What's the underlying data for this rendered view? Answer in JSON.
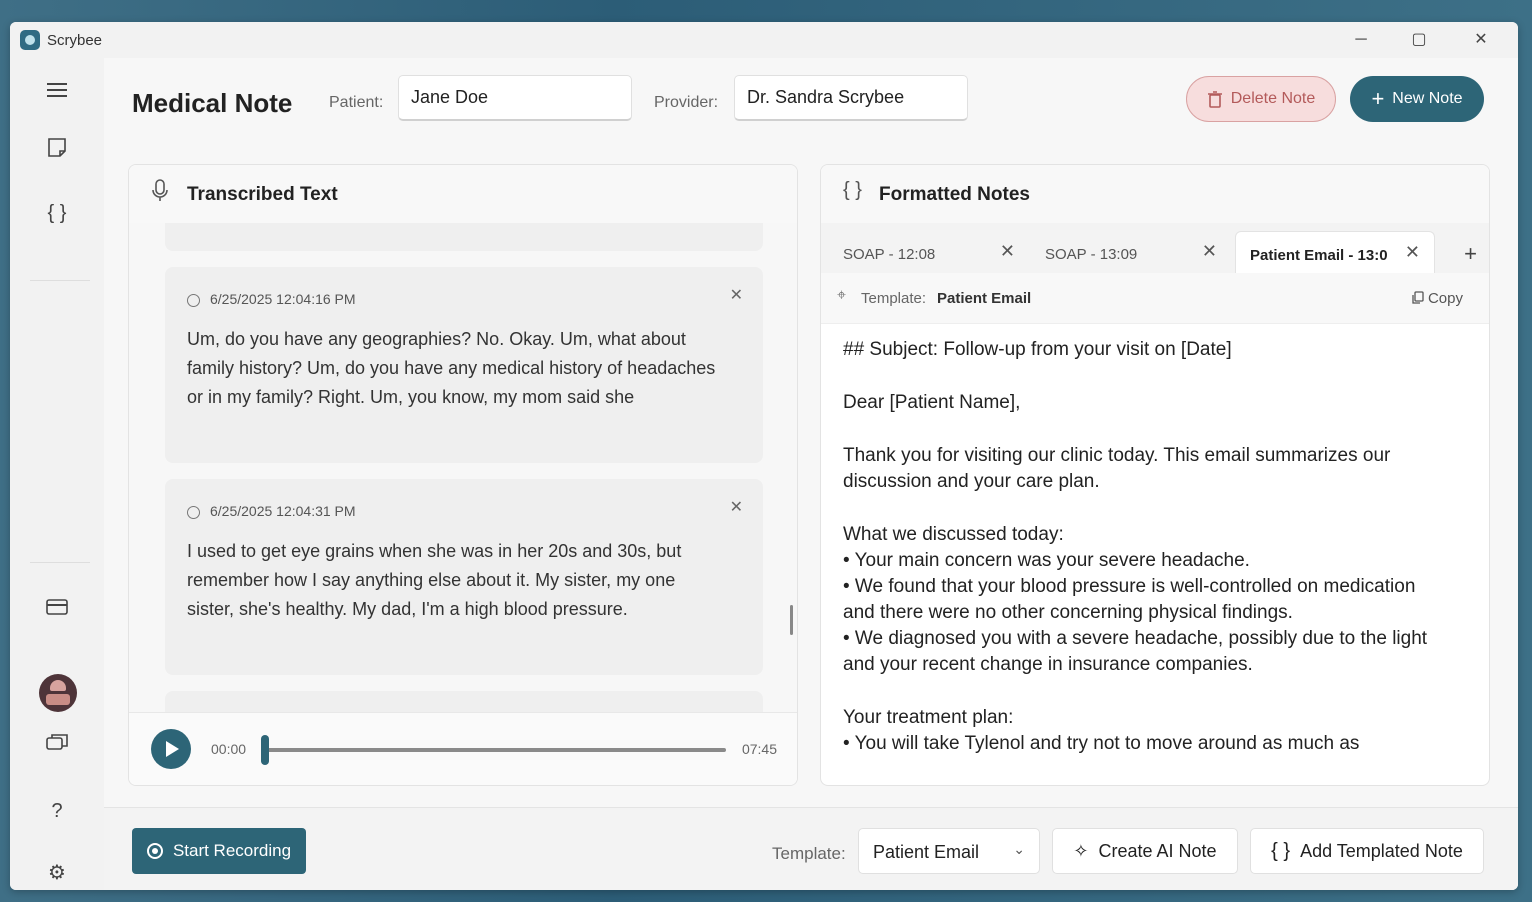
{
  "window": {
    "app_title": "Scrybee",
    "controls": {
      "minimize": "─",
      "maximize": "▢",
      "close": "✕"
    }
  },
  "sidebar": {
    "icons": [
      "hamburger-menu-icon",
      "note-icon",
      "braces-icon",
      "card-icon",
      "avatar",
      "chat-icon",
      "help-icon",
      "gear-icon"
    ]
  },
  "header": {
    "title": "Medical Note",
    "patient_label": "Patient:",
    "patient_value": "Jane Doe",
    "provider_label": "Provider:",
    "provider_value": "Dr. Sandra Scrybee",
    "delete_label": "Delete Note",
    "new_label": "New Note"
  },
  "transcript": {
    "title": "Transcribed Text",
    "entries": [
      {
        "timestamp": "6/25/2025 12:04:16 PM",
        "text": "Um, do you have any geographies? No. Okay. Um, what about family history? Um, do you have any medical history of headaches or in my family? Right. Um, you know, my mom said she"
      },
      {
        "timestamp": "6/25/2025 12:04:31 PM",
        "text": "I used to get eye grains when she was in her 20s and 30s, but remember how I say anything else about it. My sister, my one sister, she's healthy. My dad, I'm a high blood pressure."
      }
    ],
    "player": {
      "current": "00:00",
      "duration": "07:45",
      "progress": 0
    }
  },
  "notes": {
    "title": "Formatted Notes",
    "tabs": [
      {
        "label": "SOAP - 12:08",
        "active": false
      },
      {
        "label": "SOAP - 13:09",
        "active": false
      },
      {
        "label": "Patient Email - 13:0",
        "active": true
      }
    ],
    "add_tab": "+",
    "template_label": "Template:",
    "template_value": "Patient Email",
    "copy_label": "Copy",
    "body": {
      "subject": "## Subject: Follow-up from your visit on [Date]",
      "greeting": "Dear [Patient Name],",
      "intro": "Thank you for visiting our clinic today. This email summarizes our discussion and your care plan.",
      "discussed_heading": "What we discussed today:",
      "discussed": [
        "• Your main concern was your severe headache.",
        "• We found that your blood pressure is well-controlled on medication and there were no other concerning physical findings.",
        "• We diagnosed you with a severe headache, possibly due to the light and your recent change in insurance companies."
      ],
      "plan_heading": "Your treatment plan:",
      "plan": [
        "• You will take Tylenol and try not to move around as much as"
      ]
    }
  },
  "bottom": {
    "record_label": "Start Recording",
    "template_label": "Template:",
    "template_value": "Patient Email",
    "create_ai_label": "Create AI Note",
    "add_templated_label": "Add Templated Note"
  },
  "colors": {
    "accent": "#2d6577",
    "delete_bg": "#f7dddd",
    "delete_text": "#b35a5a"
  }
}
